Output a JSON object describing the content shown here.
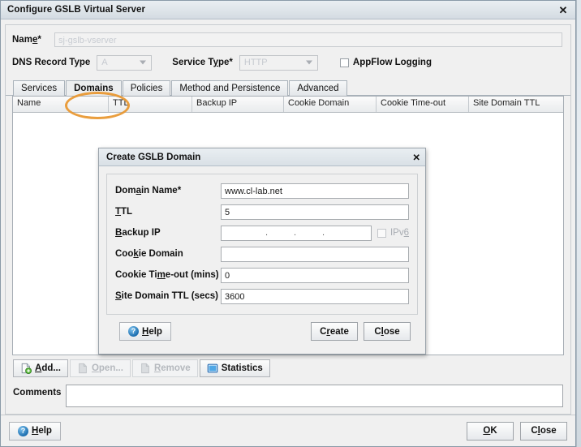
{
  "window": {
    "title": "Configure GSLB Virtual Server",
    "close_icon": "close-icon"
  },
  "form": {
    "name_label": "Name*",
    "name_value": "sj-gslb-vserver",
    "dns_record_type_label": "DNS Record Type",
    "dns_record_type_value": "A",
    "service_type_label": "Service Type*",
    "service_type_value": "HTTP",
    "appflow_label": "AppFlow Logging"
  },
  "tabs": [
    {
      "label": "Services",
      "active": false
    },
    {
      "label": "Domains",
      "active": true
    },
    {
      "label": "Policies",
      "active": false
    },
    {
      "label": "Method and Persistence",
      "active": false
    },
    {
      "label": "Advanced",
      "active": false
    }
  ],
  "annotation": {
    "shape": "ellipse",
    "color": "#e8962e",
    "target": "Domains"
  },
  "table": {
    "columns": [
      "Name",
      "TTL",
      "Backup IP",
      "Cookie Domain",
      "Cookie Time-out",
      "Site Domain TTL"
    ],
    "rows": []
  },
  "toolbar": {
    "add_label": "Add...",
    "open_label": "Open...",
    "remove_label": "Remove",
    "statistics_label": "Statistics"
  },
  "comments": {
    "label": "Comments",
    "value": ""
  },
  "footer": {
    "help_label": "Help",
    "ok_label": "OK",
    "close_label": "Close"
  },
  "modal": {
    "title": "Create GSLB Domain",
    "close_icon": "close-icon",
    "fields": [
      {
        "label": "Domain Name*",
        "value": "www.cl-lab.net"
      },
      {
        "label": "TTL",
        "value": "5"
      },
      {
        "label": "Backup IP",
        "value": ""
      },
      {
        "label": "Cookie Domain",
        "value": ""
      },
      {
        "label": "Cookie Time-out (mins)",
        "value": "0"
      },
      {
        "label": "Site Domain TTL (secs)",
        "value": "3600"
      }
    ],
    "ipv6_label": "IPv6",
    "help_label": "Help",
    "create_label": "Create",
    "close_label": "Close"
  }
}
